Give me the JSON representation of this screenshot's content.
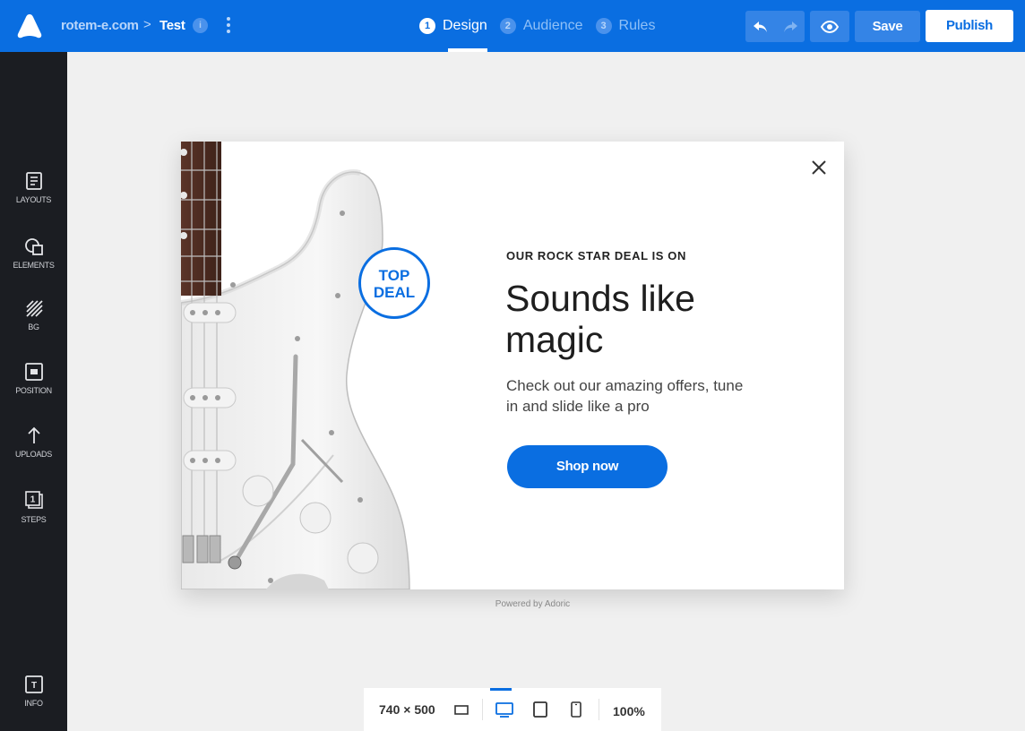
{
  "header": {
    "logo": "adoric-logo-icon",
    "breadcrumb": {
      "site": "rotem-e.com",
      "separator": ">",
      "page": "Test",
      "info_icon": "i"
    },
    "steps": [
      {
        "num": "1",
        "label": "Design",
        "active": true
      },
      {
        "num": "2",
        "label": "Audience",
        "active": false
      },
      {
        "num": "3",
        "label": "Rules",
        "active": false
      }
    ],
    "save_label": "Save",
    "publish_label": "Publish"
  },
  "sidebar": {
    "items": [
      {
        "label": "LAYOUTS",
        "icon": "layouts-icon"
      },
      {
        "label": "ELEMENTS",
        "icon": "elements-icon"
      },
      {
        "label": "BG",
        "icon": "background-icon"
      },
      {
        "label": "POSITION",
        "icon": "position-icon"
      },
      {
        "label": "UPLOADS",
        "icon": "upload-icon"
      },
      {
        "label": "STEPS",
        "icon": "steps-icon"
      }
    ],
    "info": {
      "label": "INFO",
      "icon": "info-icon"
    }
  },
  "popup": {
    "badge_line1": "TOP",
    "badge_line2": "DEAL",
    "eyebrow": "OUR ROCK STAR DEAL IS ON",
    "headline": "Sounds like magic",
    "description": "Check out our amazing offers, tune in and slide like a pro",
    "cta": "Shop now"
  },
  "powered_by": "Powered by Adoric",
  "toolbar": {
    "dimensions": "740 × 500",
    "zoom": "100%",
    "devices": [
      "desktop",
      "tablet",
      "mobile"
    ],
    "active_device": "desktop"
  },
  "colors": {
    "brand": "#0a6ee1",
    "sidebar": "#1b1d22",
    "canvas": "#f0f0f0"
  }
}
